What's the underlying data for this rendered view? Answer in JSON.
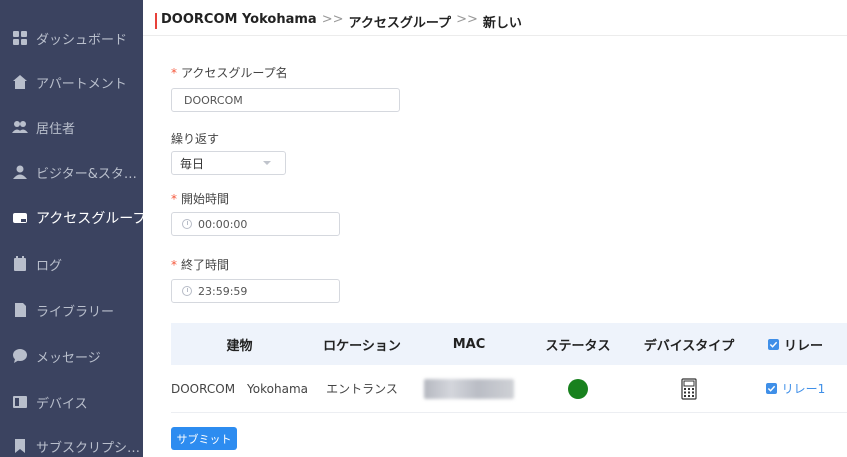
{
  "sidebar": {
    "items": [
      {
        "label": "ダッシュボード",
        "icon": "dashboard-icon"
      },
      {
        "label": "アパートメント",
        "icon": "apartment-icon"
      },
      {
        "label": "居住者",
        "icon": "residents-icon"
      },
      {
        "label": "ビジター&スタ…",
        "icon": "visitor-icon"
      },
      {
        "label": "アクセスグループ",
        "icon": "access-group-icon",
        "active": true
      },
      {
        "label": "ログ",
        "icon": "log-icon"
      },
      {
        "label": "ライブラリー",
        "icon": "library-icon"
      },
      {
        "label": "メッセージ",
        "icon": "message-icon"
      },
      {
        "label": "デバイス",
        "icon": "device-icon"
      },
      {
        "label": "サブスクリプシ…",
        "icon": "subscription-icon"
      }
    ]
  },
  "breadcrumb": {
    "root": "DOORCOM Yokohama",
    "sep1": ">>",
    "section": "アクセスグループ",
    "sep2": ">>",
    "current": "新しい"
  },
  "form": {
    "required_mark": "*",
    "name_label": "アクセスグループ名",
    "name_value": "DOORCOM",
    "repeat_label": "繰り返す",
    "repeat_value": "毎日",
    "start_label": "開始時間",
    "start_value": "00:00:00",
    "end_label": "終了時間",
    "end_value": "23:59:59"
  },
  "table": {
    "headers": [
      "建物",
      "ロケーション",
      "MAC",
      "ステータス",
      "デバイスタイプ",
      "リレー"
    ],
    "rows": [
      {
        "building": "DOORCOM　Yokohama",
        "location": "エントランス",
        "status_color": "#18811e",
        "device_type_icon": "device-type-icon",
        "relay": "リレー1"
      }
    ]
  },
  "submit_label": "サブミット",
  "colors": {
    "sidebar": "#3b4360",
    "accent": "#2d8cf0",
    "required": "#f5583c",
    "status_online": "#18811e"
  }
}
